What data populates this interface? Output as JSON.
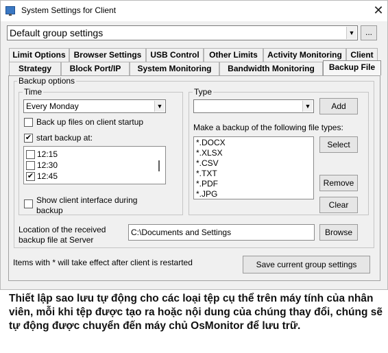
{
  "window": {
    "title": "System Settings for Client",
    "close_glyph": "✕"
  },
  "group_select": {
    "value": "Default group settings",
    "browse_label": "..."
  },
  "tabs_row1": [
    "Limit Options",
    "Browser Settings",
    "USB Control",
    "Other Limits",
    "Activity Monitoring",
    "Client"
  ],
  "tabs_row2": [
    "Strategy",
    "Block Port/IP",
    "System Monitoring",
    "Bandwidth Monitoring",
    "Backup File"
  ],
  "active_tab": "Backup File",
  "backup": {
    "legend": "Backup options",
    "time": {
      "legend": "Time",
      "schedule_value": "Every Monday",
      "startup_label": "Back up files on client startup",
      "startup_checked": false,
      "start_at_label": "start backup at:",
      "start_at_checked": true,
      "times": [
        {
          "label": "12:15",
          "checked": false
        },
        {
          "label": "12:30",
          "checked": false
        },
        {
          "label": "12:45",
          "checked": true
        }
      ],
      "show_interface_label_1": "Show client interface during",
      "show_interface_label_2": "backup",
      "show_interface_checked": false
    },
    "type": {
      "legend": "Type",
      "type_value": "",
      "add_label": "Add",
      "file_types_label": "Make a backup of the following file types:",
      "file_types": [
        "*.DOCX",
        "*.XLSX",
        "*.CSV",
        "*.TXT",
        "*.PDF",
        "*.JPG"
      ],
      "select_label": "Select",
      "remove_label": "Remove",
      "clear_label": "Clear"
    },
    "location_label_1": "Location of the received",
    "location_label_2": "backup file at Server",
    "location_value": "C:\\Documents and Settings",
    "browse_label": "Browse"
  },
  "footer": {
    "note": "Items with * will take effect after client is restarted",
    "save_label": "Save current group settings"
  },
  "caption": "Thiết lập sao lưu tự động cho các loại tệp cụ thể trên máy tính của nhân viên, mỗi khi tệp được tạo ra hoặc nội dung của chúng thay đổi, chúng sẽ tự động được chuyển đến máy chủ OsMonitor để lưu trữ."
}
